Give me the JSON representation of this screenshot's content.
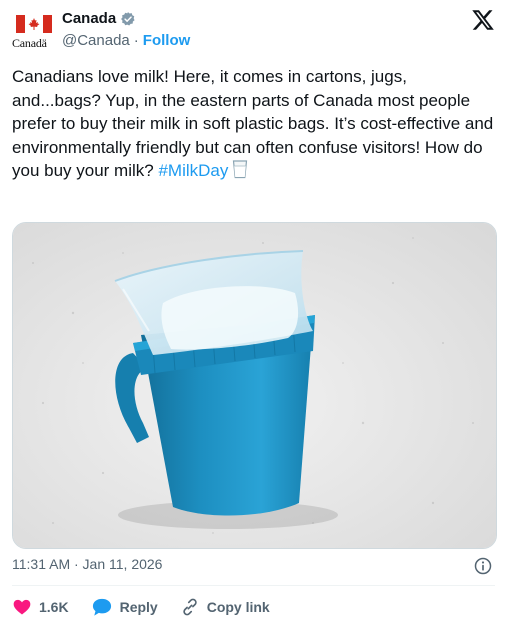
{
  "author": {
    "logo_wordmark": "Canadä",
    "display_name": "Canada",
    "handle": "@Canada",
    "separator": "·",
    "follow_label": "Follow"
  },
  "tweet": {
    "text": "Canadians love milk! Here, it comes in cartons, jugs, and...bags? Yup, in the eastern parts of Canada most people prefer to buy their milk in soft plastic bags. It’s cost-effective and environmentally friendly but can often confuse visitors! How do you buy your milk?",
    "hashtag": "#MilkDay",
    "emoji_icon": "cup-with-milk-icon"
  },
  "media": {
    "description_icon": "photo",
    "colors": {
      "pitcher": "#1d8fc1",
      "countertop": "#e9e9e9",
      "bag": "#d6ecf5"
    }
  },
  "meta": {
    "timestamp": "11:31 AM · Jan 11, 2026"
  },
  "actions": {
    "like_count": "1.6K",
    "reply_label": "Reply",
    "copy_link_label": "Copy link"
  },
  "colors": {
    "accent": "#1d9bf0",
    "like": "#f91880",
    "text": "#0f1419",
    "secondary": "#536471",
    "verified": "#829aab"
  }
}
